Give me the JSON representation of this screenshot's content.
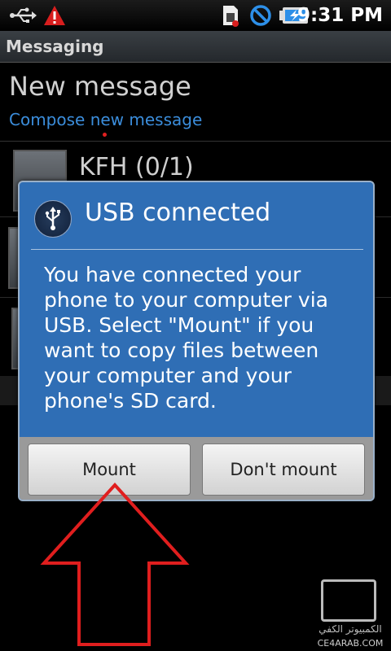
{
  "status_bar": {
    "time": "9:31 PM",
    "icons": [
      "usb-icon",
      "warning-icon",
      "sim-icon",
      "no-signal-icon",
      "battery-charging-icon"
    ]
  },
  "title_bar": {
    "title": "Messaging"
  },
  "header": {
    "title": "New message",
    "subtitle": "Compose new message"
  },
  "conversations": [
    {
      "name": "KFH (0/1)"
    }
  ],
  "dialog": {
    "title": "USB connected",
    "body": "You have connected your\nphone to your computer via\nUSB. Select \"Mount\" if you\nwant to copy files between\nyour computer and your\nphone's SD card.",
    "buttons": {
      "primary": "Mount",
      "secondary": "Don't mount"
    }
  },
  "watermark": {
    "arabic": "الكمبيوتر الكفي",
    "site": "CE4ARAB.COM"
  },
  "colors": {
    "dialog_bg": "#2f6eb5",
    "accent_link": "#3b8ddb",
    "annotation_arrow": "#e01e1e",
    "warning": "#d81e1e"
  }
}
